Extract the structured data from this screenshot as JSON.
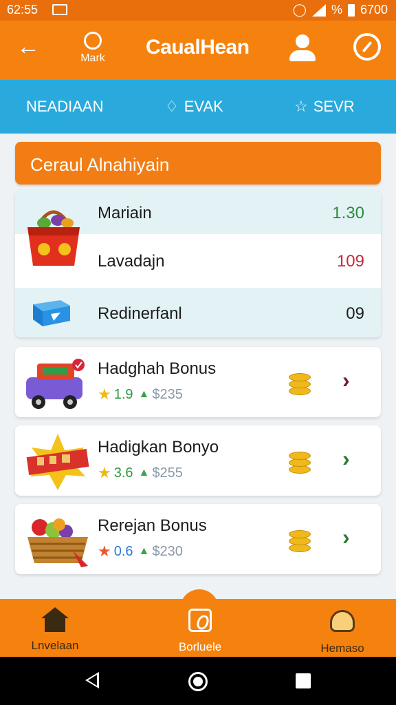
{
  "status_bar": {
    "time": "62:55",
    "right_text": "%",
    "battery_text": "6700"
  },
  "app_bar": {
    "mark_label": "Mark",
    "title": "CaualHean"
  },
  "tabs": [
    {
      "label": "NEADIAAN",
      "icon": ""
    },
    {
      "label": "EVAK",
      "icon": "tag-icon"
    },
    {
      "label": "SEVR",
      "icon": "star-outline-icon"
    }
  ],
  "section_title": "Ceraul Alnahiyain",
  "summary": [
    {
      "label": "Mariain",
      "value": "1.30",
      "color": "#2a8c38"
    },
    {
      "label": "Lavadajn",
      "value": "109",
      "color": "#c32a3d"
    },
    {
      "label": "Redinerfanl",
      "value": "09",
      "color": "#1d1d1d"
    }
  ],
  "bonuses": [
    {
      "name": "Hadghah Bonus",
      "rating": "1.9",
      "price": "$235",
      "art": "toy-truck-image"
    },
    {
      "name": "Hadigkan Bonyo",
      "rating": "3.6",
      "price": "$255",
      "art": "sale-star-badge-image"
    },
    {
      "name": "Rerejan Bonus",
      "rating": "0.6",
      "price": "$230",
      "art": "fruit-basket-image"
    }
  ],
  "bottom_nav": [
    {
      "label": "Lnvelaan",
      "icon": "home-icon"
    },
    {
      "label": "Borluele",
      "icon": "bonus-icon"
    },
    {
      "label": "Hemaso",
      "icon": "profile-icon"
    }
  ],
  "colors": {
    "primary": "#f5820e",
    "tab_strip": "#29a9dc",
    "section": "#f27d14"
  }
}
